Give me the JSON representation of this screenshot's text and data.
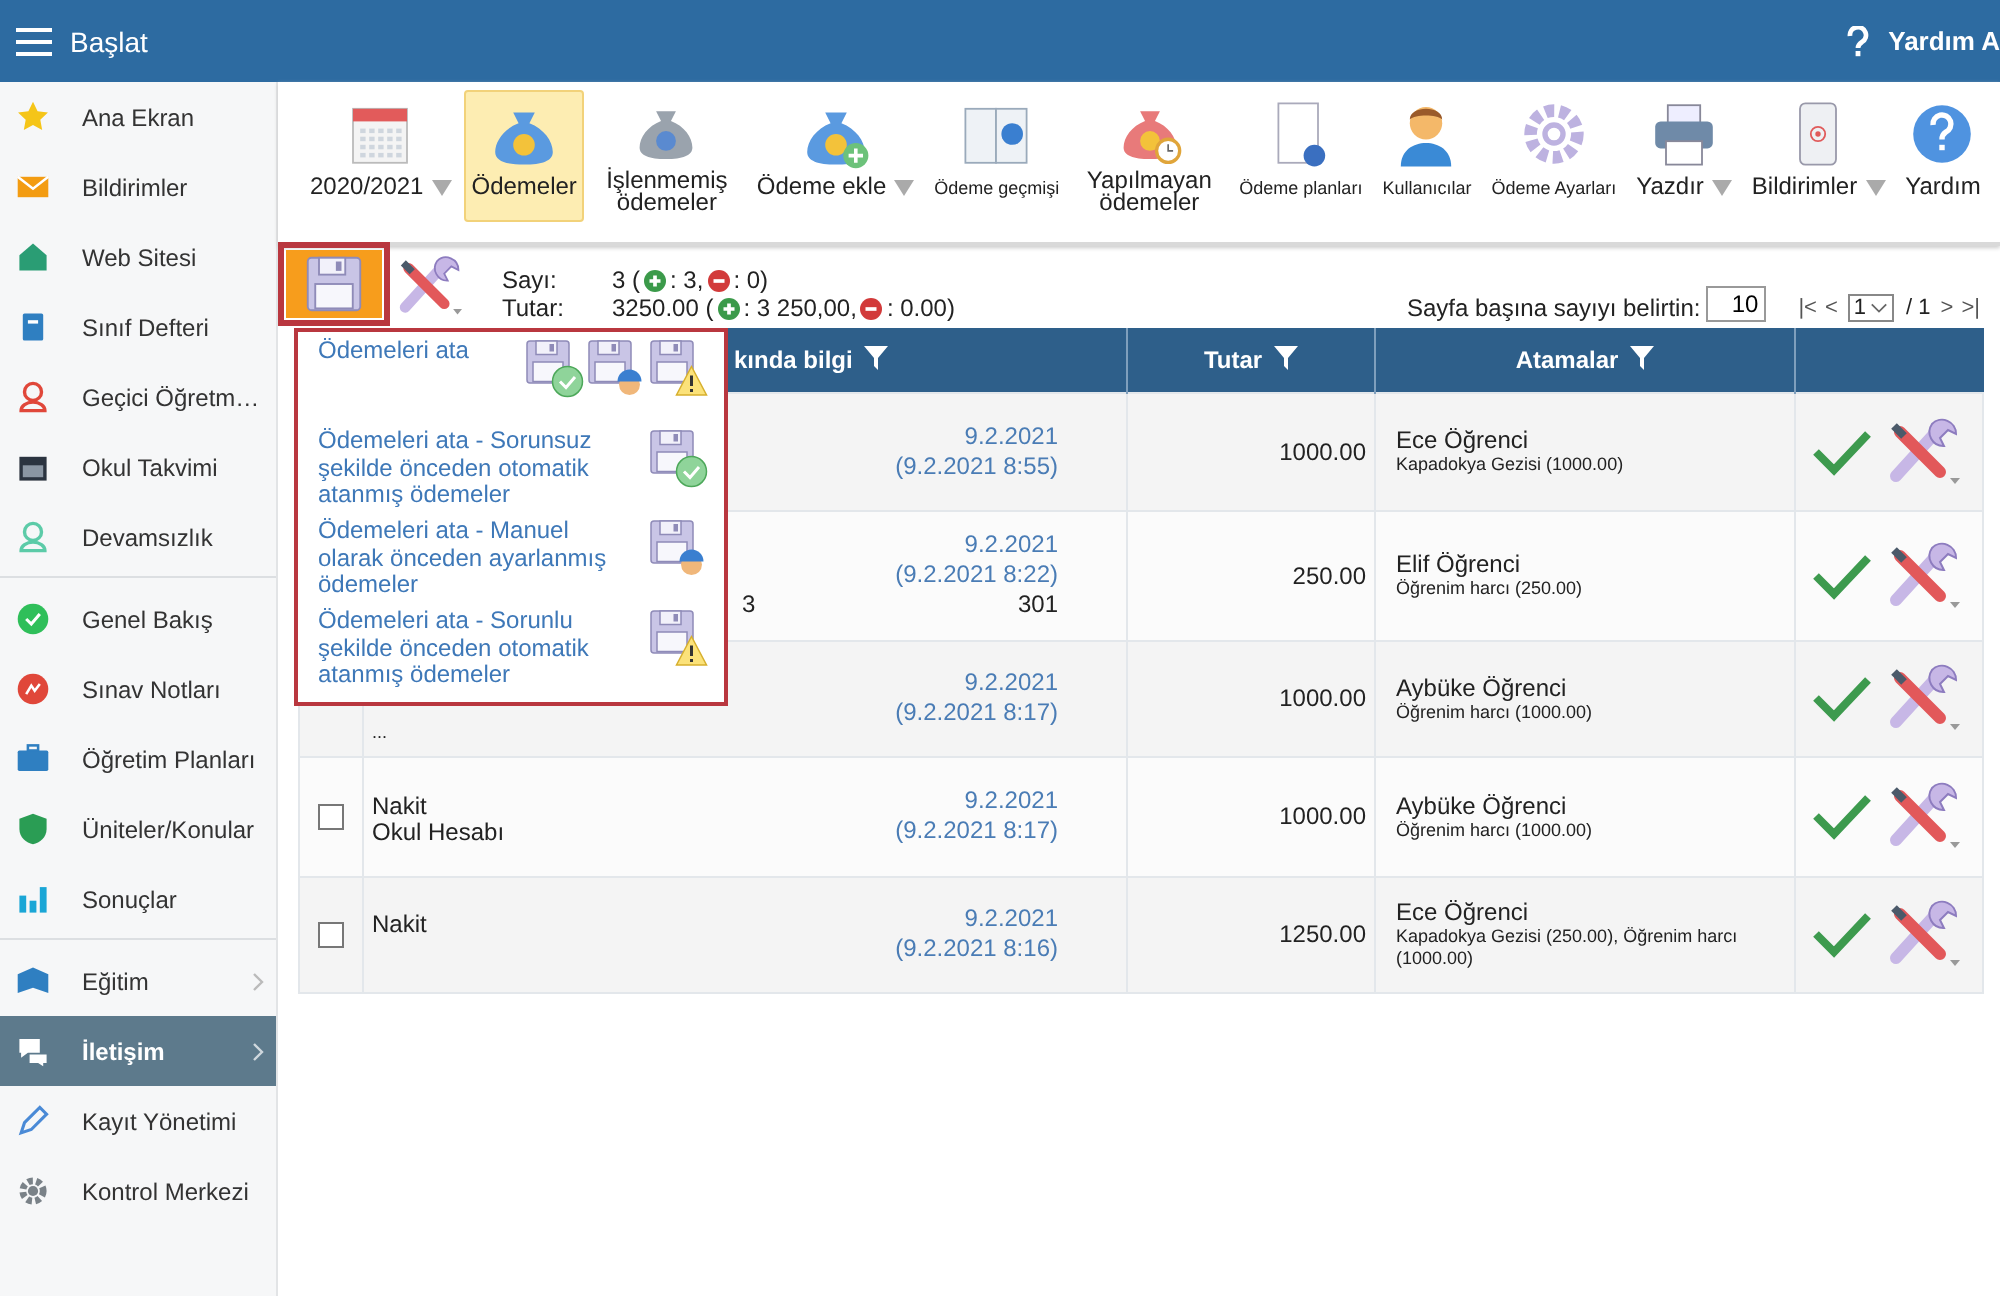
{
  "header": {
    "title": "Başlat",
    "help_label": "Yardım A"
  },
  "sidebar": {
    "groups": [
      [
        {
          "label": "Ana Ekran",
          "selected": false,
          "expandable": false
        },
        {
          "label": "Bildirimler",
          "selected": false,
          "expandable": false
        },
        {
          "label": "Web Sitesi",
          "selected": false,
          "expandable": false
        },
        {
          "label": "Sınıf Defteri",
          "selected": false,
          "expandable": false
        },
        {
          "label": "Geçici Öğretm…",
          "selected": false,
          "expandable": false
        },
        {
          "label": "Okul Takvimi",
          "selected": false,
          "expandable": false
        },
        {
          "label": "Devamsızlık",
          "selected": false,
          "expandable": false
        }
      ],
      [
        {
          "label": "Genel Bakış",
          "selected": false,
          "expandable": false
        },
        {
          "label": "Sınav Notları",
          "selected": false,
          "expandable": false
        },
        {
          "label": "Öğretim Planları",
          "selected": false,
          "expandable": false
        },
        {
          "label": "Üniteler/Konular",
          "selected": false,
          "expandable": false
        },
        {
          "label": "Sonuçlar",
          "selected": false,
          "expandable": false
        }
      ],
      [
        {
          "label": "Eğitim",
          "selected": false,
          "expandable": true
        },
        {
          "label": "İletişim",
          "selected": true,
          "expandable": true
        },
        {
          "label": "Kayıt Yönetimi",
          "selected": false,
          "expandable": false
        },
        {
          "label": "Kontrol Merkezi",
          "selected": false,
          "expandable": false
        }
      ]
    ]
  },
  "toolbar": [
    {
      "label": "2020/2021",
      "selected": false,
      "caret": true,
      "small": false
    },
    {
      "label": "Ödemeler",
      "selected": true,
      "caret": false,
      "small": false
    },
    {
      "label": "İşlenmemiş ödemeler",
      "selected": false,
      "caret": false,
      "small": false
    },
    {
      "label": "Ödeme ekle",
      "selected": false,
      "caret": true,
      "small": false
    },
    {
      "label": "Ödeme geçmişi",
      "selected": false,
      "caret": false,
      "small": true
    },
    {
      "label": "Yapılmayan ödemeler",
      "selected": false,
      "caret": false,
      "small": false
    },
    {
      "label": "Ödeme planları",
      "selected": false,
      "caret": false,
      "small": true
    },
    {
      "label": "Kullanıcılar",
      "selected": false,
      "caret": false,
      "small": true
    },
    {
      "label": "Ödeme Ayarları",
      "selected": false,
      "caret": false,
      "small": true
    },
    {
      "label": "Yazdır",
      "selected": false,
      "caret": true,
      "small": false
    },
    {
      "label": "Bildirimler",
      "selected": false,
      "caret": true,
      "small": false
    },
    {
      "label": "Yardım",
      "selected": false,
      "caret": false,
      "small": false
    }
  ],
  "summary": {
    "lines": [
      {
        "label": "Sayı:",
        "parts": [
          {
            "kind": "text",
            "text": "3 ("
          },
          {
            "kind": "plus"
          },
          {
            "kind": "text",
            "text": ": 3,"
          },
          {
            "kind": "minus"
          },
          {
            "kind": "text",
            "text": ": 0)"
          }
        ]
      },
      {
        "label": "Tutar:",
        "parts": [
          {
            "kind": "text",
            "text": "3250.00 ("
          },
          {
            "kind": "plus"
          },
          {
            "kind": "text",
            "text": ": 3 250,00,"
          },
          {
            "kind": "minus"
          },
          {
            "kind": "text",
            "text": ": 0.00)"
          }
        ]
      }
    ]
  },
  "paging": {
    "per_page_label": "Sayfa başına sayıyı belirtin:",
    "per_page": "10",
    "first": "|<",
    "prev": "<",
    "page": "1",
    "of": "/ 1",
    "next": ">",
    "last": ">|"
  },
  "assign_menu": {
    "items": [
      {
        "label": "Ödemeleri ata",
        "badges": [
          {
            "kind": "ok"
          },
          {
            "kind": "worker"
          },
          {
            "kind": "warning"
          }
        ]
      },
      {
        "label": "Ödemeleri ata - Sorunsuz şekilde önceden otomatik atanmış ödemeler",
        "badges": [
          {
            "kind": "ok"
          }
        ]
      },
      {
        "label": "Ödemeleri ata - Manuel olarak önceden ayarlanmış ödemeler",
        "badges": [
          {
            "kind": "worker"
          }
        ]
      },
      {
        "label": "Ödemeleri ata - Sorunlu şekilde önceden otomatik atanmış ödemeler",
        "badges": [
          {
            "kind": "warning"
          }
        ]
      }
    ]
  },
  "table": {
    "columns": [
      "kında bilgi",
      "Tutar",
      "Atamalar"
    ],
    "rows": [
      {
        "date": "9.2.2021",
        "datetime": "(9.2.2021 8:55)",
        "amount": "1000.00",
        "assignee": "Ece Öğrenci",
        "assignment": "Kapadokya Gezisi (1000.00)"
      },
      {
        "tail": "3",
        "date": "9.2.2021",
        "datetime": "(9.2.2021 8:22)",
        "reference": "301",
        "amount": "250.00",
        "assignee": "Elif Öğrenci",
        "assignment": "Öğrenim harcı (250.00)"
      },
      {
        "overflow_mark": "...",
        "date": "9.2.2021",
        "datetime": "(9.2.2021 8:17)",
        "amount": "1000.00",
        "assignee": "Aybüke Öğrenci",
        "assignment": "Öğrenim harcı (1000.00)"
      },
      {
        "checked": false,
        "lines": [
          "Nakit",
          "Okul Hesabı"
        ],
        "date": "9.2.2021",
        "datetime": "(9.2.2021 8:17)",
        "amount": "1000.00",
        "assignee": "Aybüke Öğrenci",
        "assignment": "Öğrenim harcı (1000.00)"
      },
      {
        "checked": false,
        "lines": [
          "Nakit"
        ],
        "date": "9.2.2021",
        "datetime": "(9.2.2021 8:16)",
        "amount": "1250.00",
        "assignee": "Ece Öğrenci",
        "assignment": "Kapadokya Gezisi (250.00), Öğrenim harcı (1000.00)"
      }
    ]
  }
}
